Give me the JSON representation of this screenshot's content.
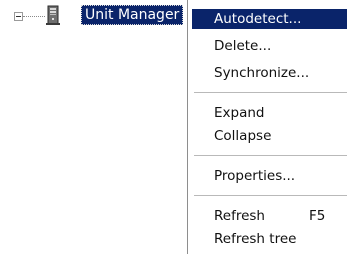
{
  "tree": {
    "node_label": "Unit Manager",
    "node_icon": "tower-computer-icon",
    "expander_icon": "collapse-minus-icon"
  },
  "context_menu": {
    "items": [
      {
        "label": "Autodetect...",
        "selected": true
      },
      {
        "label": "Delete..."
      },
      {
        "label": "Synchronize..."
      },
      {
        "label": "Expand"
      },
      {
        "label": "Collapse"
      },
      {
        "label": "Properties..."
      },
      {
        "label": "Refresh",
        "shortcut": "F5"
      },
      {
        "label": "Refresh tree"
      }
    ]
  },
  "colors": {
    "selection_background": "#0a246a",
    "selection_text": "#ffffff",
    "menu_background": "#ffffff"
  }
}
